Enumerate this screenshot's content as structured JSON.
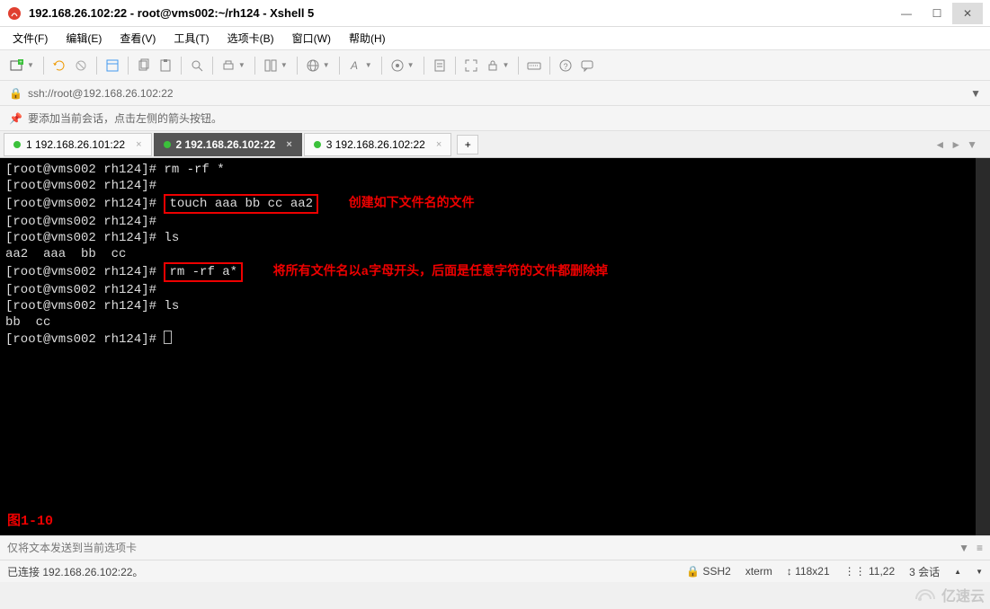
{
  "window": {
    "title": "192.168.26.102:22 - root@vms002:~/rh124 - Xshell 5",
    "minimize_label": "—",
    "maximize_label": "☐",
    "close_label": "✕"
  },
  "menu": {
    "file": "文件(F)",
    "edit": "编辑(E)",
    "view": "查看(V)",
    "tools": "工具(T)",
    "tab": "选项卡(B)",
    "window": "窗口(W)",
    "help": "帮助(H)"
  },
  "address": {
    "lock": "🔒",
    "url": "ssh://root@192.168.26.102:22"
  },
  "hint": {
    "pin": "📌",
    "text": "要添加当前会话，点击左侧的箭头按钮。"
  },
  "tabs": {
    "items": [
      {
        "label": "1 192.168.26.101:22",
        "active": false
      },
      {
        "label": "2 192.168.26.102:22",
        "active": true
      },
      {
        "label": "3 192.168.26.102:22",
        "active": false
      }
    ],
    "add_label": "+"
  },
  "terminal": {
    "lines": [
      {
        "prompt": "[root@vms002 rh124]# ",
        "cmd": "rm -rf *",
        "boxed": false,
        "annot": ""
      },
      {
        "prompt": "[root@vms002 rh124]# ",
        "cmd": "",
        "boxed": false,
        "annot": ""
      },
      {
        "prompt": "[root@vms002 rh124]# ",
        "cmd": "touch aaa bb cc aa2",
        "boxed": true,
        "annot": "创建如下文件名的文件"
      },
      {
        "prompt": "[root@vms002 rh124]# ",
        "cmd": "",
        "boxed": false,
        "annot": ""
      },
      {
        "prompt": "[root@vms002 rh124]# ",
        "cmd": "ls",
        "boxed": false,
        "annot": ""
      },
      {
        "prompt": "",
        "cmd": "aa2  aaa  bb  cc",
        "boxed": false,
        "annot": ""
      },
      {
        "prompt": "[root@vms002 rh124]# ",
        "cmd": "rm -rf a*",
        "boxed": true,
        "annot": "将所有文件名以a字母开头，后面是任意字符的文件都删除掉"
      },
      {
        "prompt": "[root@vms002 rh124]# ",
        "cmd": "",
        "boxed": false,
        "annot": ""
      },
      {
        "prompt": "[root@vms002 rh124]# ",
        "cmd": "ls",
        "boxed": false,
        "annot": ""
      },
      {
        "prompt": "",
        "cmd": "bb  cc",
        "boxed": false,
        "annot": ""
      },
      {
        "prompt": "[root@vms002 rh124]# ",
        "cmd": "",
        "boxed": false,
        "annot": "",
        "cursor": true
      }
    ],
    "figure_label": "图1-10"
  },
  "compose": {
    "placeholder": "仅将文本发送到当前选项卡"
  },
  "status": {
    "connected": "已连接 192.168.26.102:22。",
    "proto": "SSH2",
    "term": "xterm",
    "size": "118x21",
    "pos": "11,22",
    "sessions_label": "3 会话"
  },
  "watermark": "亿速云"
}
